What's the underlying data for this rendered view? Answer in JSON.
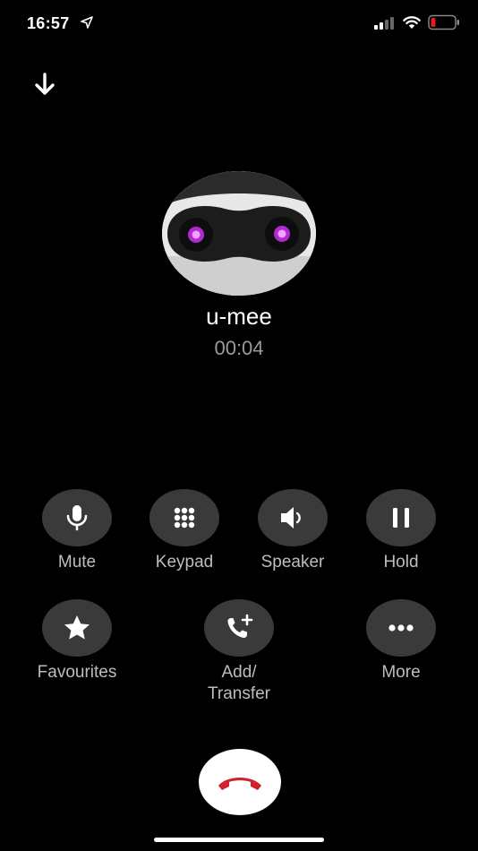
{
  "status_bar": {
    "time": "16:57",
    "icons": [
      "location-arrow-icon",
      "cellular-signal-icon",
      "wifi-icon",
      "battery-low-icon"
    ],
    "battery_color": "#e02020"
  },
  "header": {
    "minimize_icon": "arrow-down-icon"
  },
  "caller": {
    "name": "u-mee",
    "duration": "00:04",
    "avatar_icon": "robot-avatar-icon",
    "eye_color": "#e040ff"
  },
  "controls": {
    "row1": [
      {
        "label": "Mute",
        "icon": "microphone-icon"
      },
      {
        "label": "Keypad",
        "icon": "keypad-icon"
      },
      {
        "label": "Speaker",
        "icon": "speaker-icon"
      },
      {
        "label": "Hold",
        "icon": "pause-icon"
      }
    ],
    "row2": [
      {
        "label": "Favourites",
        "icon": "star-icon"
      },
      {
        "label_line1": "Add/",
        "label_line2": "Transfer",
        "icon": "add-call-icon"
      },
      {
        "label": "More",
        "icon": "more-dots-icon"
      }
    ]
  },
  "end_call": {
    "icon": "hang-up-icon",
    "color": "#d0222b"
  }
}
